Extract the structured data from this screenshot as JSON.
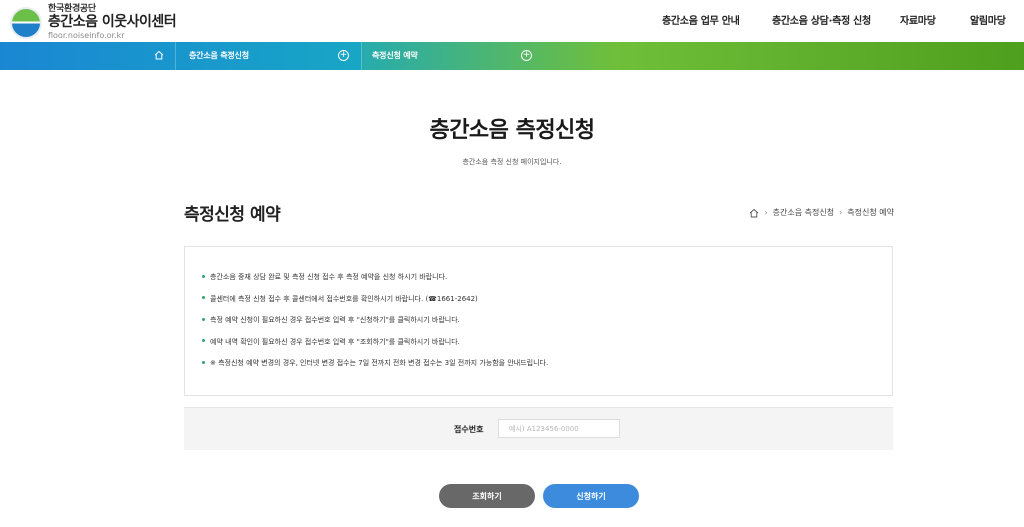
{
  "header": {
    "org_name": "한국환경공단",
    "site_name": "층간소음 이웃사이센터",
    "site_url": "floor.noiseinfo.or.kr",
    "gnb": [
      "층간소음 업무 안내",
      "층간소음 상담·측정 신청",
      "자료마당",
      "알림마당"
    ]
  },
  "navbar": {
    "item1": "층간소음 측정신청",
    "item2": "측정신청 예약"
  },
  "page": {
    "title": "층간소음 측정신청",
    "subtitle": "층간소음 측정 신청 페이지입니다."
  },
  "section": {
    "title": "측정신청 예약",
    "breadcrumb": [
      "층간소음 측정신청",
      "측정신청 예약"
    ]
  },
  "notices": [
    "층간소음 중재 상담 완료 및 측정 신청 접수 후 측정 예약을 신청 하시기 바랍니다.",
    "콜센터에 측정 신청 접수 후 콜센터에서 접수번호를 확인하시기 바랍니다. (☎1661-2642)",
    "측정 예약 신청이 필요하신 경우 접수번호 입력 후 \"신청하기\"를 클릭하시기 바랍니다.",
    "예약 내역 확인이 필요하신 경우 접수번호 입력 후 \"조회하기\"를 클릭하시기 바랍니다.",
    "※ 측정신청 예약 변경의 경우, 인터넷 변경 접수는 7일 전까지 전화 변경 접수는 3일 전까지 가능함을 안내드립니다."
  ],
  "form": {
    "label": "접수번호",
    "placeholder": "예시) A123456-0000",
    "value": ""
  },
  "buttons": {
    "query": "조회하기",
    "apply": "신청하기"
  },
  "colors": {
    "nav_blue": "#1a87d3",
    "nav_green": "#6fbf3a",
    "apply_button": "#3c8bdc",
    "query_button": "#686868",
    "bullet": "#3aa26a"
  }
}
